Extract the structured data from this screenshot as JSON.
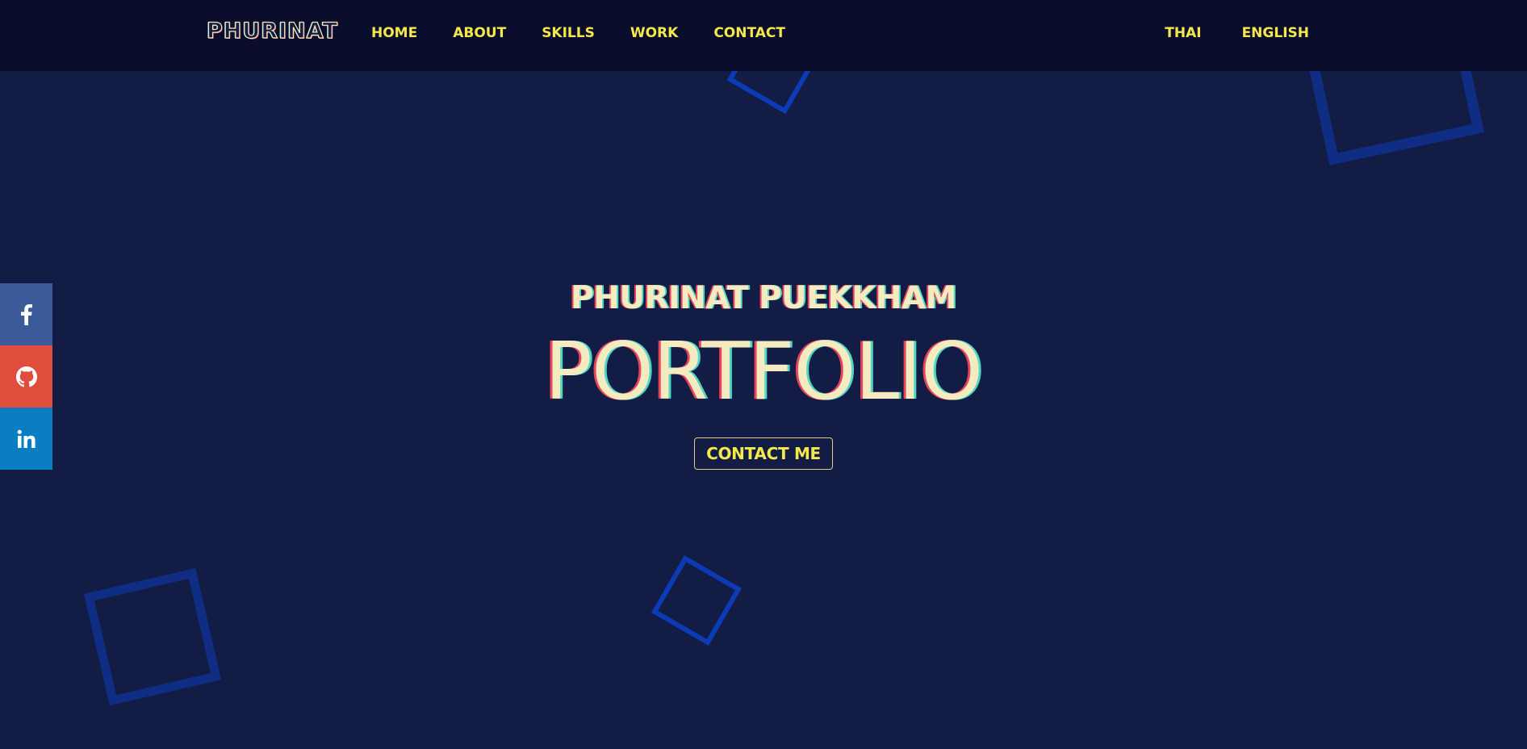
{
  "header": {
    "logo": "PHURINAT",
    "nav": [
      "HOME",
      "ABOUT",
      "SKILLS",
      "WORK",
      "CONTACT"
    ],
    "languages": [
      "THAI",
      "ENGLISH"
    ]
  },
  "social": [
    {
      "name": "facebook-icon"
    },
    {
      "name": "github-icon"
    },
    {
      "name": "linkedin-icon"
    }
  ],
  "hero": {
    "name": "PHURINAT PUEKKHAM",
    "title": "PORTFOLIO",
    "cta_label": "CONTACT ME"
  },
  "colors": {
    "background": "#121c45",
    "navbar": "#0a0d2c",
    "accent": "#f5e84a",
    "facebook": "#3c5a9a",
    "github": "#e04d3d",
    "linkedin": "#0a7ec0"
  }
}
